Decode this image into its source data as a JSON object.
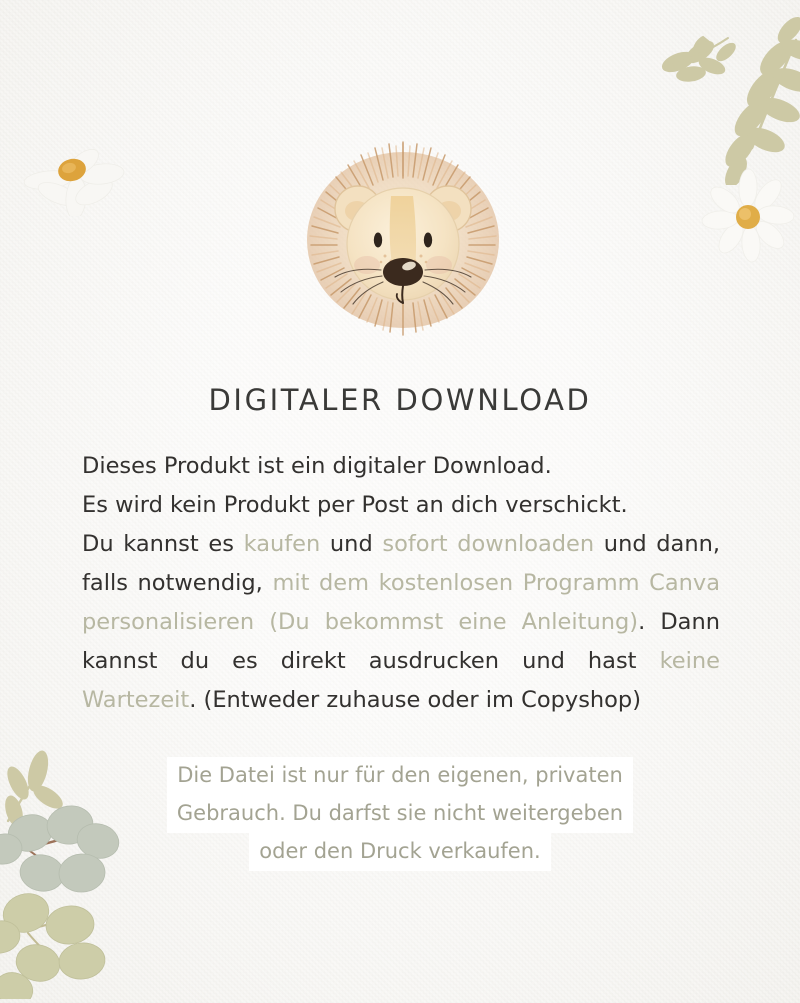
{
  "page": {
    "background_color": "#f6f5f2",
    "heading": "DIGITALER DOWNLOAD",
    "text_color": "#33312f",
    "accent_sage": "#b7b7a2",
    "notice_text_color": "#a3a392",
    "highlight_color": "#ffffff"
  },
  "illustration": {
    "name": "watercolor-lion-head",
    "mane_color": "#c8996a",
    "face_color": "#f4e2c4",
    "nose_color": "#3b2a1e",
    "blush_color": "#e7bfa8"
  },
  "decorations": {
    "top_right_branches": {
      "name": "olive-branch-pair",
      "color": "#cdc9a5"
    },
    "bottom_left_branches": {
      "name": "eucalyptus-branch-pair",
      "leaf_color_grey": "#c3c9bc",
      "leaf_color_olive": "#cdcda8",
      "stem_color": "#9c7259",
      "sprig_color": "#cdc9a5"
    },
    "daisy_left": {
      "name": "daisy-flower",
      "petal_color": "#f7f6f3",
      "center_color": "#dda33c"
    },
    "daisy_right": {
      "name": "daisy-flower",
      "petal_color": "#f9f8f5",
      "center_color": "#e0ad48"
    }
  },
  "body": {
    "line1": "Dieses Produkt ist ein digitaler Download.",
    "line2": "Es wird kein Produkt per Post an dich verschickt.",
    "flow": {
      "seg1_dark": "Du kannst es ",
      "seg2_sage": "kaufen",
      "seg3_dark": " und ",
      "seg4_sage": "sofort downloaden",
      "seg5_dark": " und dann, falls notwendig, ",
      "seg6_sage": "mit dem kostenlosen Programm Canva personalisieren (Du bekommst eine Anleitung)",
      "seg7_dark": ". Dann kannst du es direkt ausdrucken und hast ",
      "seg8_sage": "keine Wartezeit",
      "seg9_dark": ". (Entweder zuhause oder im Copyshop)"
    }
  },
  "notice": {
    "line1": "Die Datei ist nur für den eigenen, privaten",
    "line2": "Gebrauch. Du darfst sie nicht weitergeben",
    "line3": "oder den Druck verkaufen."
  }
}
